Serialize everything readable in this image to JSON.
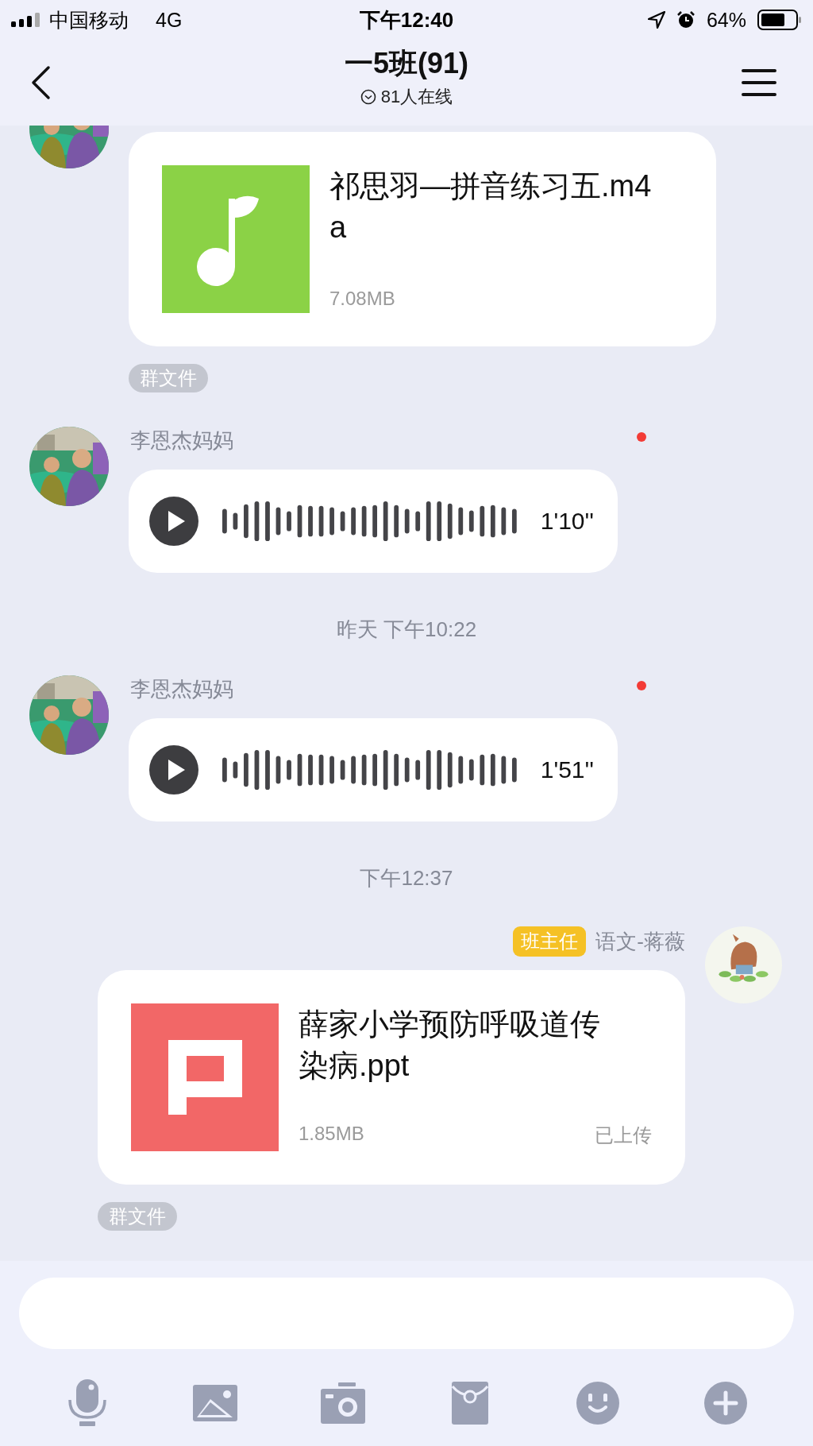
{
  "status_bar": {
    "carrier": "中国移动",
    "network": "4G",
    "time": "下午12:40",
    "battery": "64%"
  },
  "header": {
    "title": "一5班(91)",
    "subtitle": "81人在线"
  },
  "messages": [
    {
      "kind": "incoming_file",
      "file": {
        "kind": "audio",
        "name": "祁思羽—拼音练习五.m4a",
        "size": "7.08MB"
      },
      "tag": "群文件"
    },
    {
      "kind": "incoming_voice",
      "sender": "李恩杰妈妈",
      "duration": "1'10''",
      "unread": true
    },
    {
      "kind": "time",
      "text": "昨天 下午10:22"
    },
    {
      "kind": "incoming_voice",
      "sender": "李恩杰妈妈",
      "duration": "1'51''",
      "unread": true
    },
    {
      "kind": "time",
      "text": "下午12:37"
    },
    {
      "kind": "outgoing_file",
      "sender": "语文-蒋薇",
      "role": "班主任",
      "file": {
        "kind": "presentation",
        "name": "薛家小学预防呼吸道传染病.ppt",
        "size": "1.85MB",
        "status": "已上传"
      },
      "tag": "群文件"
    }
  ]
}
